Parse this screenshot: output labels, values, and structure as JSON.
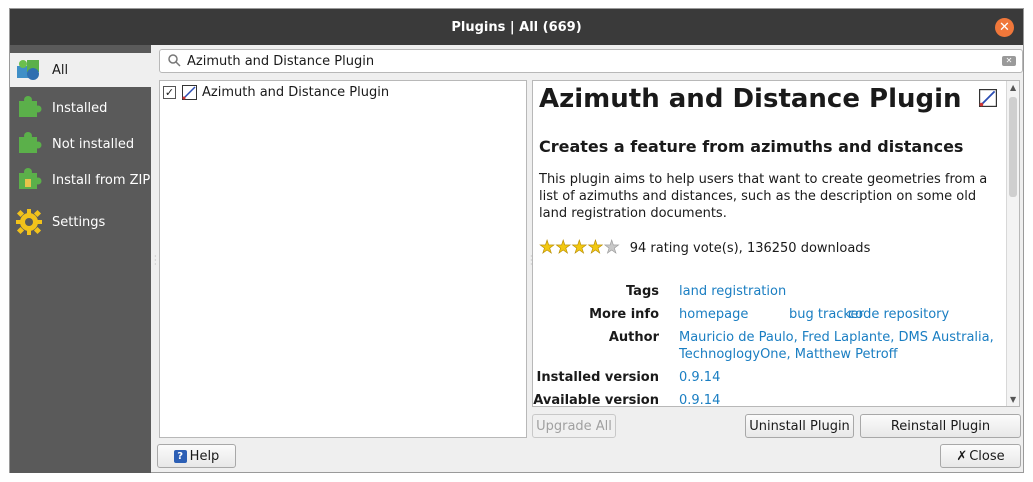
{
  "window": {
    "title": "Plugins | All (669)"
  },
  "sidebar": {
    "items": [
      {
        "label": "All",
        "icon": "puzzle-all-icon"
      },
      {
        "label": "Installed",
        "icon": "puzzle-installed-icon"
      },
      {
        "label": "Not installed",
        "icon": "puzzle-not-installed-icon"
      },
      {
        "label": "Install from ZIP",
        "icon": "puzzle-zip-icon"
      },
      {
        "label": "Settings",
        "icon": "gear-icon"
      }
    ]
  },
  "search": {
    "value": "Azimuth and Distance Plugin"
  },
  "plugin_list": [
    {
      "name": "Azimuth and Distance Plugin",
      "checked": true
    }
  ],
  "details": {
    "title": "Azimuth and Distance Plugin",
    "subtitle": "Creates a feature from azimuths and distances",
    "description": "This plugin aims to help users that want to create geometries from a list of azimuths and distances, such as the description on some old land registration documents.",
    "rating": {
      "stars": 4,
      "max": 5,
      "text": "94 rating vote(s), 136250 downloads"
    },
    "meta": {
      "tags_label": "Tags",
      "tags": "land registration",
      "more_info_label": "More info",
      "homepage": "homepage",
      "bug_tracker": "bug tracker",
      "code_repository": "code repository",
      "author_label": "Author",
      "author_line1": "Mauricio de Paulo, Fred Laplante, DMS Australia,",
      "author_line2": "TechnoglogyOne, Matthew Petroff",
      "installed_version_label": "Installed version",
      "installed_version": "0.9.14",
      "available_version_label": "Available version",
      "available_version": "0.9.14"
    }
  },
  "buttons": {
    "upgrade_all": "Upgrade All",
    "uninstall": "Uninstall Plugin",
    "reinstall": "Reinstall Plugin",
    "help": "Help",
    "close": "Close"
  },
  "colors": {
    "titlebar": "#3a3a3a",
    "sidebar": "#5a5a5a",
    "link": "#1a7ec2",
    "close_button": "#f0773a"
  }
}
